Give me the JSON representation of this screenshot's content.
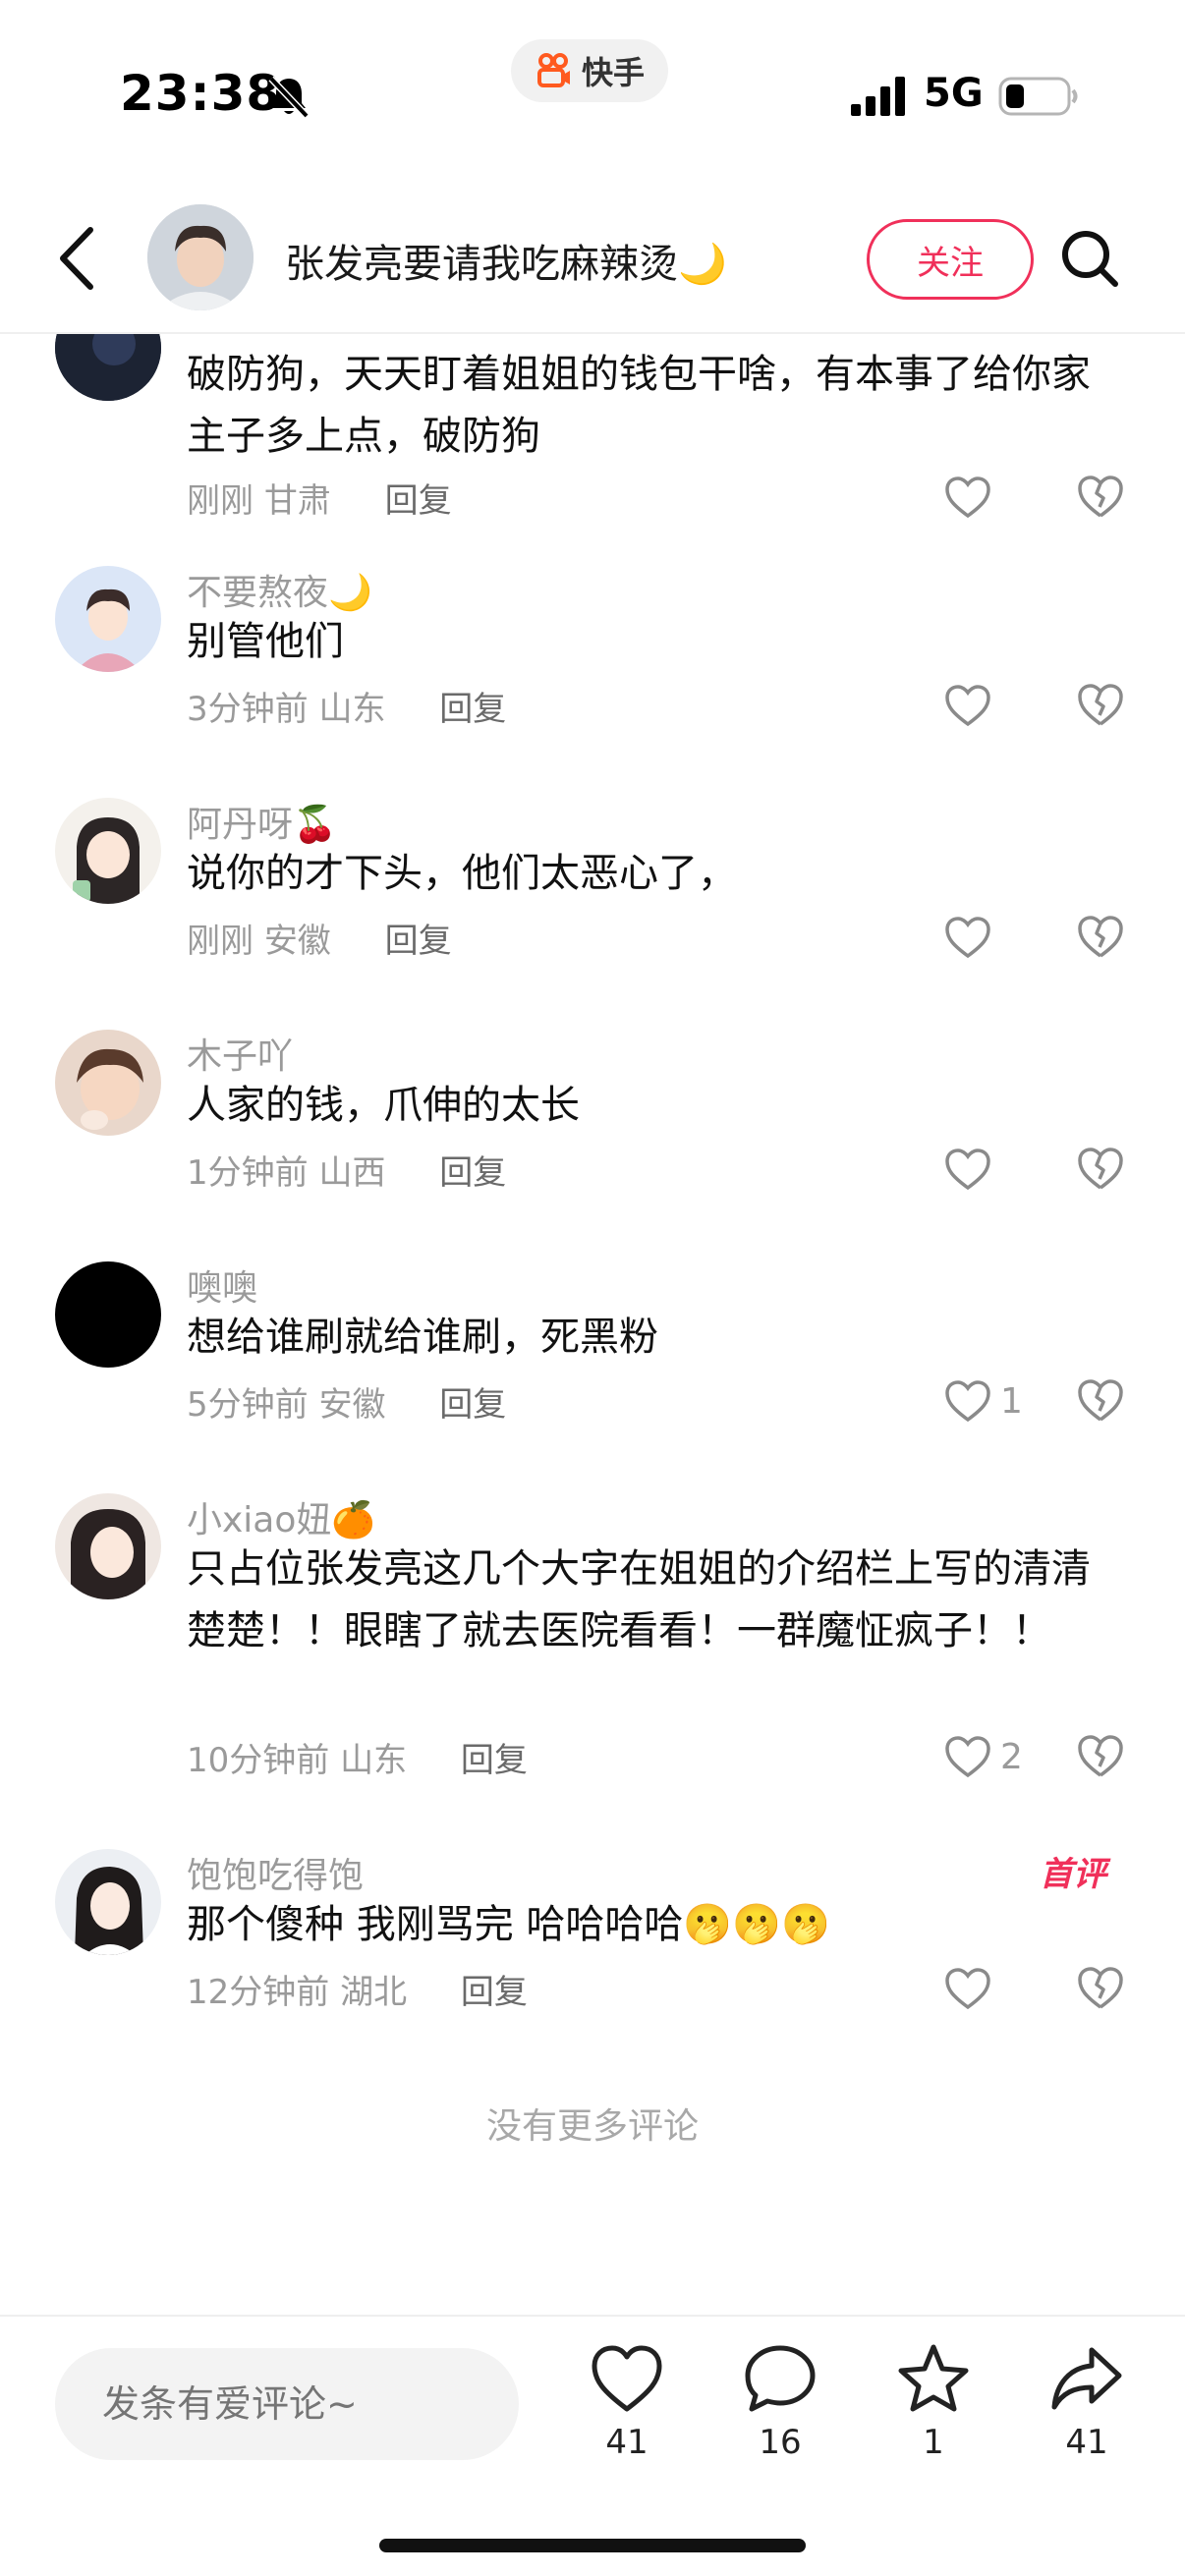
{
  "status_bar": {
    "time": "23:38",
    "app_name": "快手",
    "network": "5G",
    "icons": [
      "bell-muted-icon",
      "kuaishou-logo-icon",
      "signal-icon",
      "battery-icon"
    ]
  },
  "header": {
    "title": "张发亮要请我吃麻辣烫🌙",
    "follow_label": "关注",
    "icons": [
      "back-arrow-icon",
      "search-icon"
    ]
  },
  "comments": [
    {
      "name": "",
      "text": "破防狗，天天盯着姐姐的钱包干啥，有本事了给你家主子多上点，破防狗",
      "time": "刚刚",
      "location": "甘肃",
      "reply": "回复",
      "likes": ""
    },
    {
      "name": "不要熬夜🌙",
      "text": "别管他们",
      "time": "3分钟前",
      "location": "山东",
      "reply": "回复",
      "likes": ""
    },
    {
      "name": "阿丹呀🍒",
      "text": "说你的才下头，他们太恶心了，",
      "time": "刚刚",
      "location": "安徽",
      "reply": "回复",
      "likes": ""
    },
    {
      "name": "木子吖",
      "text": "人家的钱，爪伸的太长",
      "time": "1分钟前",
      "location": "山西",
      "reply": "回复",
      "likes": ""
    },
    {
      "name": "噢噢",
      "text": "想给谁刷就给谁刷，死黑粉",
      "time": "5分钟前",
      "location": "安徽",
      "reply": "回复",
      "likes": "1"
    },
    {
      "name": "小xiao妞🍊",
      "text": "只占位张发亮这几个大字在姐姐的介绍栏上写的清清楚楚！！眼瞎了就去医院看看！一群魔怔疯子！！",
      "time": "10分钟前",
      "location": "山东",
      "reply": "回复",
      "likes": "2"
    },
    {
      "name": "饱饱吃得饱",
      "text": "那个傻种 我刚骂完 哈哈哈哈🫢🫢🫢",
      "time": "12分钟前",
      "location": "湖北",
      "reply": "回复",
      "likes": "",
      "badge": "首评"
    }
  ],
  "no_more": "没有更多评论",
  "bottom_bar": {
    "input_placeholder": "发条有爱评论~",
    "actions": [
      {
        "icon": "heart-icon",
        "count": "41"
      },
      {
        "icon": "comment-icon",
        "count": "16"
      },
      {
        "icon": "star-icon",
        "count": "1"
      },
      {
        "icon": "share-icon",
        "count": "41"
      }
    ]
  },
  "colors": {
    "accent": "#f0305a",
    "muted_text": "#9a9a9a",
    "icon_gray": "#8a8a8a"
  }
}
